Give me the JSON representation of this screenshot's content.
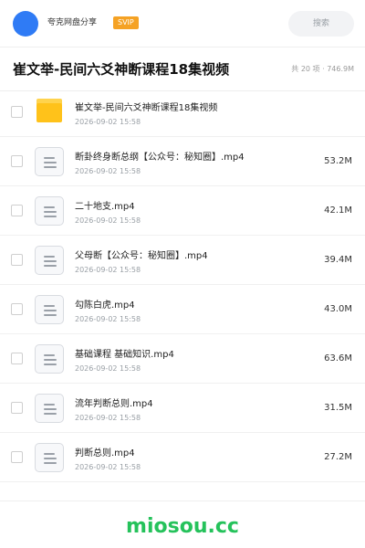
{
  "header": {
    "share_label": "夸克网盘分享",
    "svip_badge": "SVIP",
    "search_label": "搜索"
  },
  "folder": {
    "title": "崔文举-民间六爻神断课程18集视频",
    "meta": "共 20 项 · 746.9M"
  },
  "files": [
    {
      "name": "崔文举-民间六爻神断课程18集视频",
      "date": "2026-09-02 15:58",
      "size": "",
      "icon": "folder-icon"
    },
    {
      "name": "断卦终身断总纲【公众号：秘知圈】.mp4",
      "date": "2026-09-02 15:58",
      "size": "53.2M",
      "icon": "document-icon"
    },
    {
      "name": "二十地支.mp4",
      "date": "2026-09-02 15:58",
      "size": "42.1M",
      "icon": "document-icon"
    },
    {
      "name": "父母断【公众号：秘知圈】.mp4",
      "date": "2026-09-02 15:58",
      "size": "39.4M",
      "icon": "document-icon"
    },
    {
      "name": "勾陈白虎.mp4",
      "date": "2026-09-02 15:58",
      "size": "43.0M",
      "icon": "document-icon"
    },
    {
      "name": "基础课程 基础知识.mp4",
      "date": "2026-09-02 15:58",
      "size": "63.6M",
      "icon": "document-icon"
    },
    {
      "name": "流年判断总则.mp4",
      "date": "2026-09-02 15:58",
      "size": "31.5M",
      "icon": "document-icon"
    },
    {
      "name": "判断总则.mp4",
      "date": "2026-09-02 15:58",
      "size": "27.2M",
      "icon": "document-icon"
    }
  ],
  "watermark": "miosou.cc",
  "colors": {
    "accent_blue": "#2f7bf5",
    "svip_orange": "#f5a224",
    "folder_yellow": "#ffc21a",
    "watermark_green": "#25c25b"
  }
}
